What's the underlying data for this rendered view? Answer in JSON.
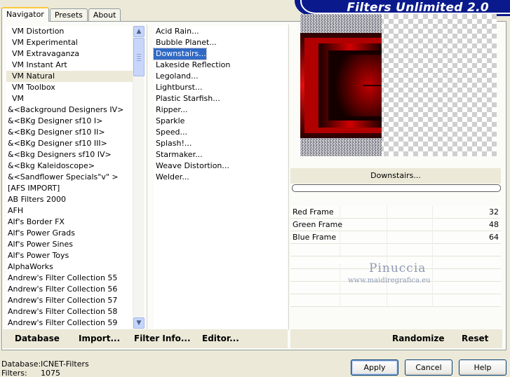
{
  "title": "Filters Unlimited 2.0",
  "tabs": [
    {
      "label": "Navigator",
      "active": true
    },
    {
      "label": "Presets",
      "active": false
    },
    {
      "label": "About",
      "active": false
    }
  ],
  "categories": [
    {
      "label": "VM Distortion",
      "indent": true
    },
    {
      "label": "VM Experimental",
      "indent": true
    },
    {
      "label": "VM Extravaganza",
      "indent": true
    },
    {
      "label": "VM Instant Art",
      "indent": true
    },
    {
      "label": "VM Natural",
      "indent": true,
      "selected": true
    },
    {
      "label": "VM Toolbox",
      "indent": true
    },
    {
      "label": "VM",
      "indent": true
    },
    {
      "label": "&<Background Designers IV>"
    },
    {
      "label": "&<BKg Designer sf10 I>"
    },
    {
      "label": "&<BKg Designer sf10 II>"
    },
    {
      "label": "&<BKg Designer sf10 III>"
    },
    {
      "label": "&<Bkg Designers sf10 IV>"
    },
    {
      "label": "&<Bkg Kaleidoscope>"
    },
    {
      "label": "&<Sandflower Specials\"v\" >"
    },
    {
      "label": "[AFS IMPORT]"
    },
    {
      "label": "AB Filters 2000"
    },
    {
      "label": "AFH"
    },
    {
      "label": "Alf's Border FX"
    },
    {
      "label": "Alf's Power Grads"
    },
    {
      "label": "Alf's Power Sines"
    },
    {
      "label": "Alf's Power Toys"
    },
    {
      "label": "AlphaWorks"
    },
    {
      "label": "Andrew's Filter Collection 55"
    },
    {
      "label": "Andrew's Filter Collection 56"
    },
    {
      "label": "Andrew's Filter Collection 57"
    },
    {
      "label": "Andrew's Filter Collection 58"
    },
    {
      "label": "Andrew's Filter Collection 59"
    }
  ],
  "filters": [
    {
      "label": "Acid Rain..."
    },
    {
      "label": "Bubble Planet..."
    },
    {
      "label": "Downstairs...",
      "selected": true
    },
    {
      "label": "Lakeside Reflection"
    },
    {
      "label": "Legoland..."
    },
    {
      "label": "Lightburst..."
    },
    {
      "label": "Plastic Starfish..."
    },
    {
      "label": "Ripper..."
    },
    {
      "label": "Sparkle"
    },
    {
      "label": "Speed..."
    },
    {
      "label": "Splash!..."
    },
    {
      "label": "Starmaker..."
    },
    {
      "label": "Weave Distortion..."
    },
    {
      "label": "Welder..."
    }
  ],
  "current_filter": "Downstairs...",
  "parameters": [
    {
      "label": "Red Frame",
      "value": "32"
    },
    {
      "label": "Green Frame",
      "value": "48"
    },
    {
      "label": "Blue Frame",
      "value": "64"
    }
  ],
  "watermark": {
    "name": "Pinuccia",
    "url": "www.maidiregrafica.eu"
  },
  "left_buttons": [
    {
      "label": "Database"
    },
    {
      "label": "Import..."
    },
    {
      "label": "Filter Info..."
    },
    {
      "label": "Editor..."
    }
  ],
  "right_buttons": [
    {
      "label": "Randomize"
    },
    {
      "label": "Reset"
    }
  ],
  "info": {
    "database_label": "Database:",
    "database_value": "ICNET-Filters",
    "filters_label": "Filters:",
    "filters_value": "1075"
  },
  "dialog_buttons": {
    "apply": "Apply",
    "cancel": "Cancel",
    "help": "Help"
  },
  "colors": {
    "banner": "#0a1a8c",
    "selection": "#316ac5",
    "window_bg": "#ece9d8"
  }
}
